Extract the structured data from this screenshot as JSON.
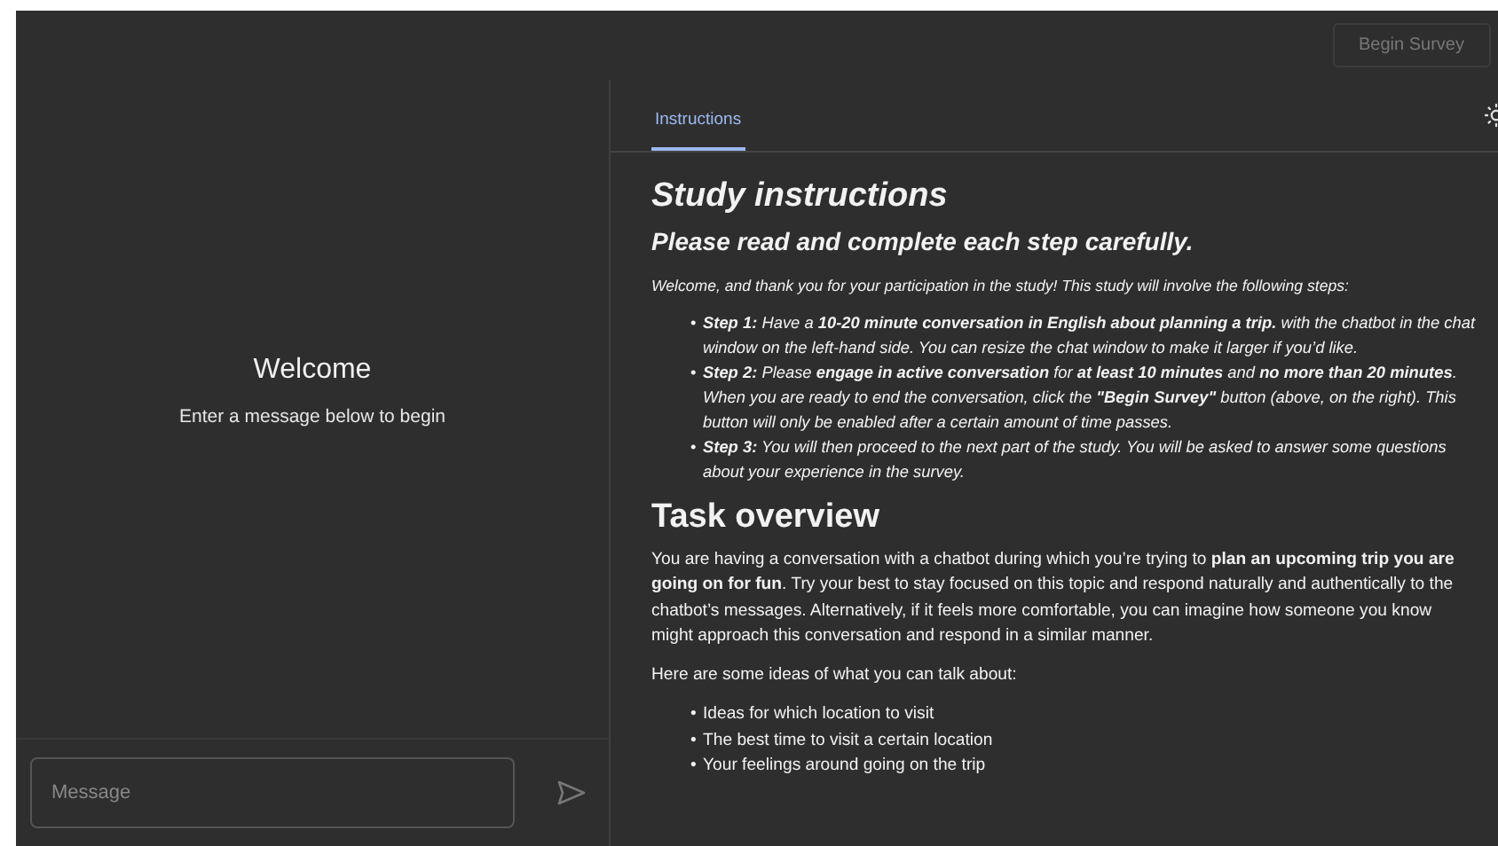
{
  "header": {
    "button": {
      "label": "Begin Survey",
      "disabled": true
    }
  },
  "chat": {
    "title": "Welcome",
    "subtitle": "Enter a message below to begin",
    "input": {
      "placeholder": "Message"
    }
  },
  "tabs": [
    {
      "label": "Instructions",
      "selected": true
    }
  ],
  "instructions": {
    "title": "Study instructions",
    "subtitle": "Please read and complete each step carefully.",
    "intro": "Welcome, and thank you for your participation in the study! This study will involve the following steps:",
    "steps": [
      {
        "marker": "•",
        "text": "**Step 1:** Have a **10-20 minute conversation in English about planning a trip.** with the chatbot in the chat window on the left-hand side. You can resize the chat window to make it larger if you’d like."
      },
      {
        "marker": "•",
        "text": "**Step 2:** Please **engage in active conversation** for **at least 10 minutes** and **no more than 20 minutes**. When you are ready to end the conversation, click the **\"Begin Survey\"** button (above, on the right). This button will only be enabled after a certain amount of time passes."
      },
      {
        "marker": "•",
        "text": "**Step 3:** You will then proceed to the next part of the study. You will be asked to answer some questions about your experience in the survey."
      }
    ],
    "overview_title": "Task overview",
    "overview": "You are having a conversation with a chatbot during which you’re trying to **plan an upcoming trip you are going on for fun**. Try your best to stay focused on this topic and respond naturally and authentically to the chatbot’s messages. Alternatively, if it feels more comfortable, you can imagine how someone you know might approach this conversation and respond in a similar manner.",
    "ideas_intro": "Here are some ideas of what you can talk about:",
    "ideas": [
      {
        "marker": "•",
        "text": "Ideas for which location to visit"
      },
      {
        "marker": "•",
        "text": "The best time to visit a certain location"
      },
      {
        "marker": "•",
        "text": "Your feelings around going on the trip"
      }
    ]
  }
}
